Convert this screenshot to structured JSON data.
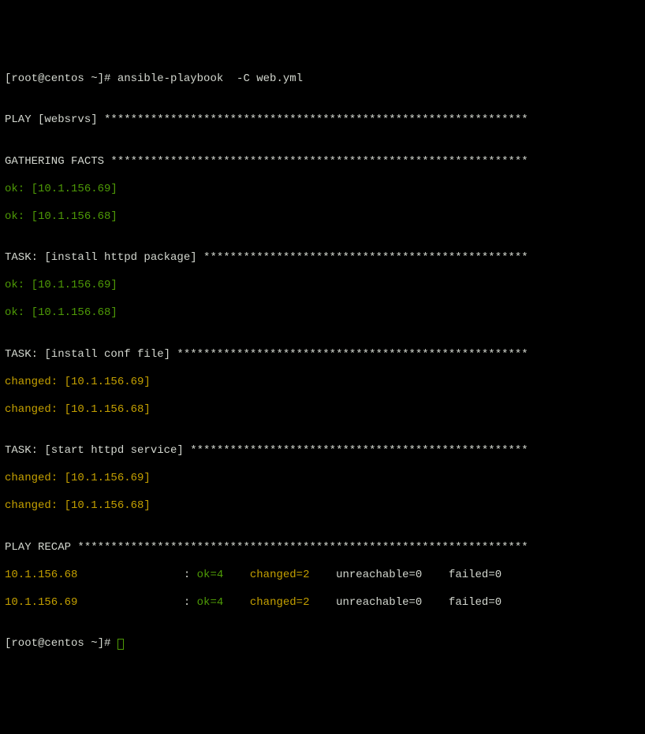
{
  "prompt1": "[root@centos ~]# ",
  "command": "ansible-playbook  -C web.yml",
  "blank": "",
  "play_header": "PLAY [websrvs] ****************************************************************",
  "gathering_header": "GATHERING FACTS ***************************************************************",
  "gather_ok1": "ok: [10.1.156.69]",
  "gather_ok2": "ok: [10.1.156.68]",
  "task1_header": "TASK: [install httpd package] *************************************************",
  "task1_ok1": "ok: [10.1.156.69]",
  "task1_ok2": "ok: [10.1.156.68]",
  "task2_header": "TASK: [install conf file] *****************************************************",
  "task2_ch1": "changed: [10.1.156.69]",
  "task2_ch2": "changed: [10.1.156.68]",
  "task3_header": "TASK: [start httpd service] ***************************************************",
  "task3_ch1": "changed: [10.1.156.69]",
  "task3_ch2": "changed: [10.1.156.68]",
  "recap_header": "PLAY RECAP ********************************************************************",
  "recap1_host": "10.1.156.68               ",
  "recap1_colon": " : ",
  "recap1_ok": "ok=4   ",
  "recap1_changed": " changed=2   ",
  "recap1_rest": " unreachable=0    failed=0   ",
  "recap2_host": "10.1.156.69               ",
  "recap2_colon": " : ",
  "recap2_ok": "ok=4   ",
  "recap2_changed": " changed=2   ",
  "recap2_rest": " unreachable=0    failed=0   ",
  "prompt2": "[root@centos ~]# "
}
